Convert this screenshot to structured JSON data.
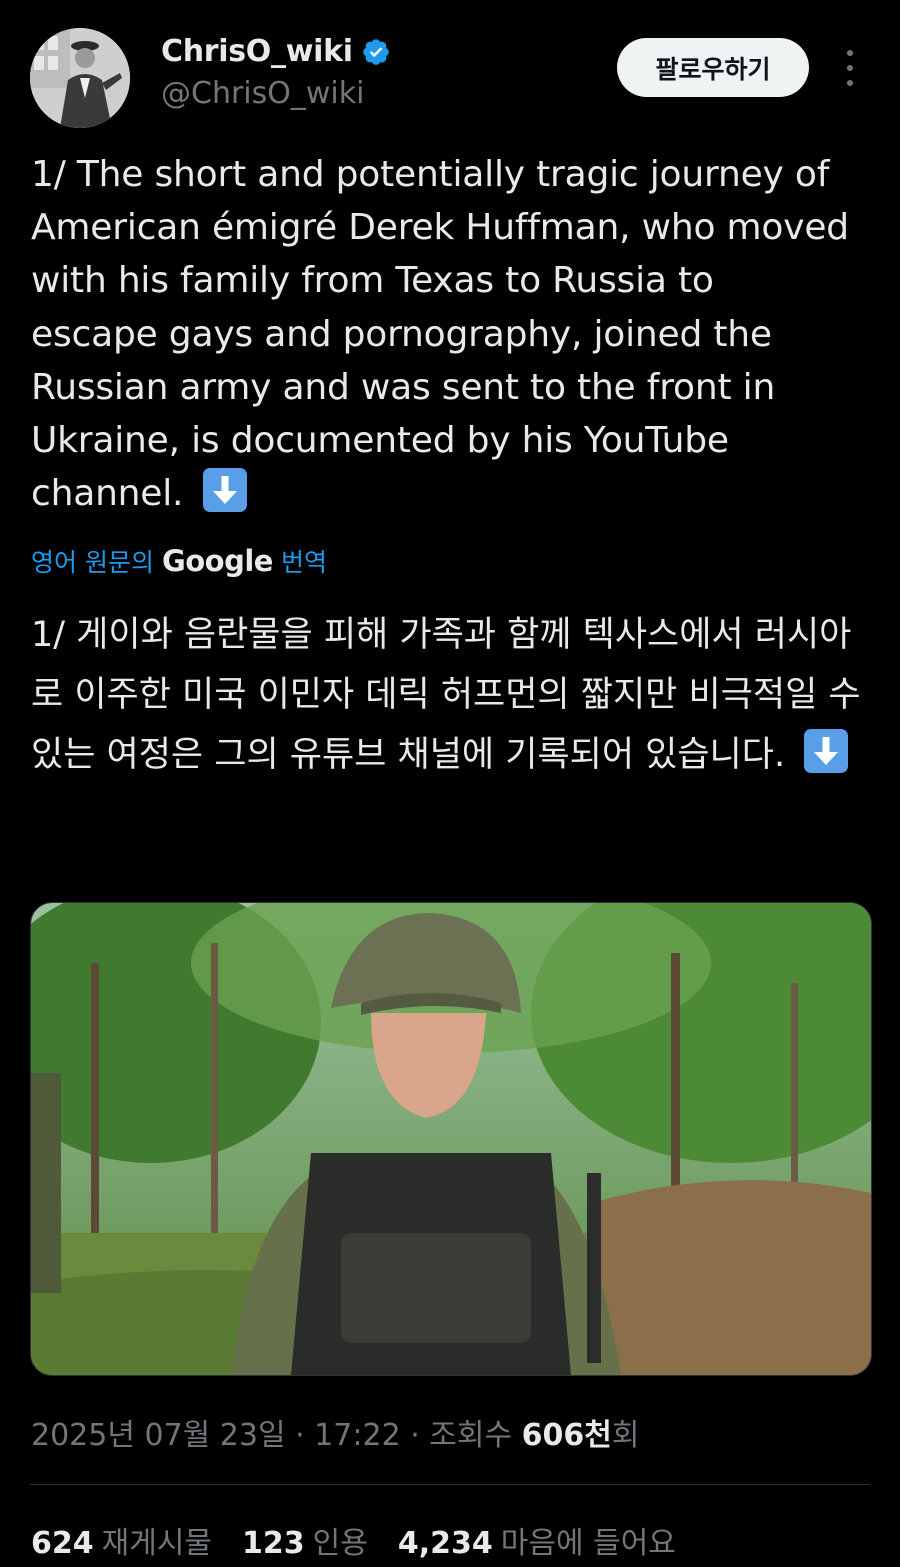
{
  "author": {
    "display_name": "ChrisO_wiki",
    "handle": "@ChrisO_wiki",
    "verified": true
  },
  "header": {
    "follow_label": "팔로우하기",
    "more_icon": "more-vertical-icon"
  },
  "tweet": {
    "text_en": "1/ The short and potentially tragic journey of American émigré Derek Huffman, who moved with his family from Texas to Russia to escape gays and pornography, joined the Russian army and was sent to the front in Ukraine, is documented by his YouTube channel.",
    "translate_prefix": "영어 원문의",
    "translate_brand": "Google",
    "translate_suffix": "번역",
    "text_ko": "1/ 게이와 음란물을 피해 가족과 함께 텍사스에서 러시아로 이주한 미국 이민자 데릭 허프먼의 짧지만 비극적일 수 있는 여정은 그의 유튜브 채널에 기록되어 있습니다.",
    "emoji": "down-arrow-emoji"
  },
  "meta": {
    "date": "2025년 07월 23일",
    "time": "17:22",
    "views_label": "조회수",
    "views_value": "606천",
    "views_suffix": "회"
  },
  "stats": {
    "retweets_value": "624",
    "retweets_label": "재게시물",
    "quotes_value": "123",
    "quotes_label": "인용",
    "likes_value": "4,234",
    "likes_label": "마음에 들어요"
  },
  "colors": {
    "background": "#000000",
    "text": "#e7e9ea",
    "muted": "#71767b",
    "link": "#1d9bf0",
    "verified": "#1d9bf0"
  }
}
